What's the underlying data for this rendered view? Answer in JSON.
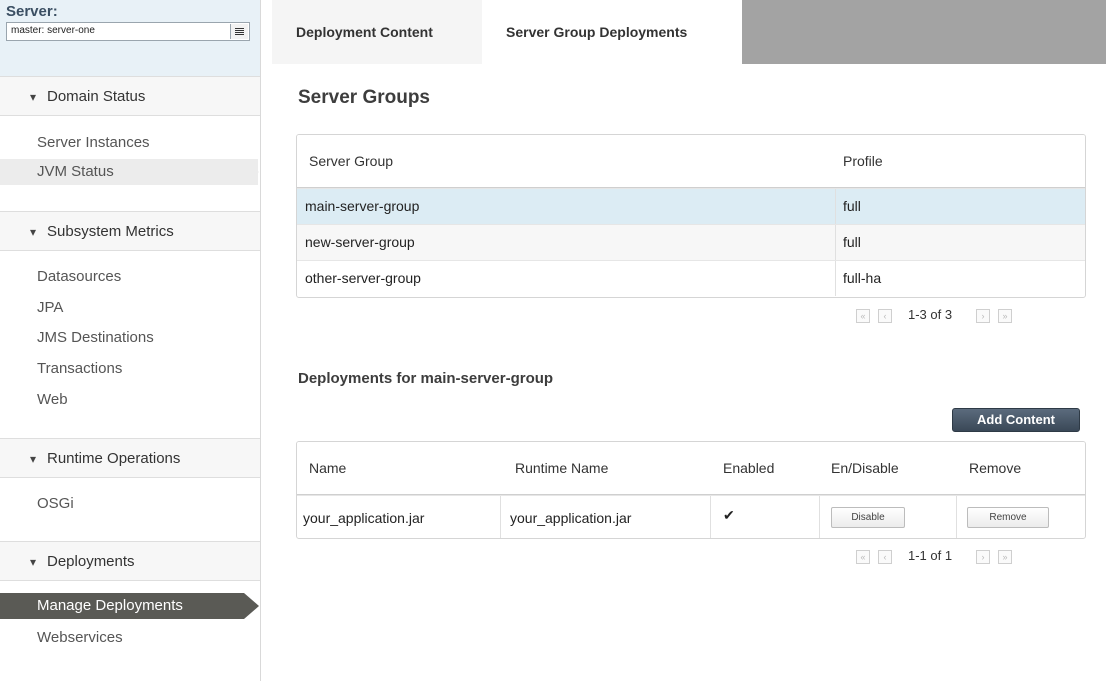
{
  "server": {
    "label": "Server:",
    "selected": "master: server-one"
  },
  "sidebar": {
    "sections": [
      {
        "title": "Domain Status",
        "items": [
          "Server Instances",
          "JVM Status"
        ]
      },
      {
        "title": "Subsystem Metrics",
        "items": [
          "Datasources",
          "JPA",
          "JMS Destinations",
          "Transactions",
          "Web"
        ]
      },
      {
        "title": "Runtime Operations",
        "items": [
          "OSGi"
        ]
      },
      {
        "title": "Deployments",
        "items": [
          "Manage Deployments",
          "Webservices"
        ]
      }
    ],
    "chevron": "▾"
  },
  "tabs": [
    "Deployment Content",
    "Server Group Deployments"
  ],
  "server_groups": {
    "title": "Server Groups",
    "columns": [
      "Server Group",
      "Profile"
    ],
    "rows": [
      [
        "main-server-group",
        "full"
      ],
      [
        "new-server-group",
        "full"
      ],
      [
        "other-server-group",
        "full-ha"
      ]
    ],
    "pager": "1-3 of 3"
  },
  "deployments": {
    "title": "Deployments for main-server-group",
    "add_label": "Add Content",
    "columns": [
      "Name",
      "Runtime Name",
      "Enabled",
      "En/Disable",
      "Remove"
    ],
    "rows": [
      {
        "name": "your_application.jar",
        "runtime": "your_application.jar",
        "enabled": "✔",
        "toggle": "Disable",
        "remove": "Remove"
      }
    ],
    "pager": "1-1 of 1"
  },
  "pager_icons": {
    "first": "«",
    "prev": "‹",
    "next": "›",
    "last": "»"
  }
}
